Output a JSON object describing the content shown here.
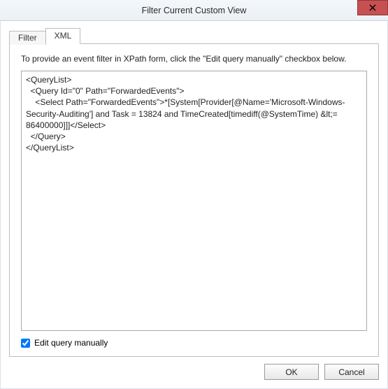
{
  "window": {
    "title": "Filter Current Custom View"
  },
  "tabs": {
    "filter": "Filter",
    "xml": "XML"
  },
  "panel": {
    "hint": "To provide an event filter in XPath form, click the \"Edit query manually\" checkbox below.",
    "query": "<QueryList>\n  <Query Id=\"0\" Path=\"ForwardedEvents\">\n    <Select Path=\"ForwardedEvents\">*[System[Provider[@Name='Microsoft-Windows-Security-Auditing'] and Task = 13824 and TimeCreated[timediff(@SystemTime) &lt;= 86400000]]]</Select>\n  </Query>\n</QueryList>",
    "edit_label": "Edit query manually",
    "edit_checked": true
  },
  "buttons": {
    "ok": "OK",
    "cancel": "Cancel"
  }
}
